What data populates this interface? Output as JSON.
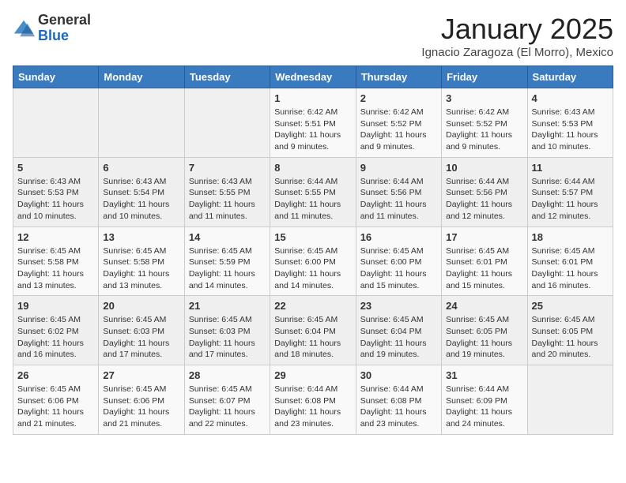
{
  "logo": {
    "general": "General",
    "blue": "Blue"
  },
  "header": {
    "title": "January 2025",
    "subtitle": "Ignacio Zaragoza (El Morro), Mexico"
  },
  "weekdays": [
    "Sunday",
    "Monday",
    "Tuesday",
    "Wednesday",
    "Thursday",
    "Friday",
    "Saturday"
  ],
  "weeks": [
    [
      {
        "day": "",
        "info": ""
      },
      {
        "day": "",
        "info": ""
      },
      {
        "day": "",
        "info": ""
      },
      {
        "day": "1",
        "info": "Sunrise: 6:42 AM\nSunset: 5:51 PM\nDaylight: 11 hours and 9 minutes."
      },
      {
        "day": "2",
        "info": "Sunrise: 6:42 AM\nSunset: 5:52 PM\nDaylight: 11 hours and 9 minutes."
      },
      {
        "day": "3",
        "info": "Sunrise: 6:42 AM\nSunset: 5:52 PM\nDaylight: 11 hours and 9 minutes."
      },
      {
        "day": "4",
        "info": "Sunrise: 6:43 AM\nSunset: 5:53 PM\nDaylight: 11 hours and 10 minutes."
      }
    ],
    [
      {
        "day": "5",
        "info": "Sunrise: 6:43 AM\nSunset: 5:53 PM\nDaylight: 11 hours and 10 minutes."
      },
      {
        "day": "6",
        "info": "Sunrise: 6:43 AM\nSunset: 5:54 PM\nDaylight: 11 hours and 10 minutes."
      },
      {
        "day": "7",
        "info": "Sunrise: 6:43 AM\nSunset: 5:55 PM\nDaylight: 11 hours and 11 minutes."
      },
      {
        "day": "8",
        "info": "Sunrise: 6:44 AM\nSunset: 5:55 PM\nDaylight: 11 hours and 11 minutes."
      },
      {
        "day": "9",
        "info": "Sunrise: 6:44 AM\nSunset: 5:56 PM\nDaylight: 11 hours and 11 minutes."
      },
      {
        "day": "10",
        "info": "Sunrise: 6:44 AM\nSunset: 5:56 PM\nDaylight: 11 hours and 12 minutes."
      },
      {
        "day": "11",
        "info": "Sunrise: 6:44 AM\nSunset: 5:57 PM\nDaylight: 11 hours and 12 minutes."
      }
    ],
    [
      {
        "day": "12",
        "info": "Sunrise: 6:45 AM\nSunset: 5:58 PM\nDaylight: 11 hours and 13 minutes."
      },
      {
        "day": "13",
        "info": "Sunrise: 6:45 AM\nSunset: 5:58 PM\nDaylight: 11 hours and 13 minutes."
      },
      {
        "day": "14",
        "info": "Sunrise: 6:45 AM\nSunset: 5:59 PM\nDaylight: 11 hours and 14 minutes."
      },
      {
        "day": "15",
        "info": "Sunrise: 6:45 AM\nSunset: 6:00 PM\nDaylight: 11 hours and 14 minutes."
      },
      {
        "day": "16",
        "info": "Sunrise: 6:45 AM\nSunset: 6:00 PM\nDaylight: 11 hours and 15 minutes."
      },
      {
        "day": "17",
        "info": "Sunrise: 6:45 AM\nSunset: 6:01 PM\nDaylight: 11 hours and 15 minutes."
      },
      {
        "day": "18",
        "info": "Sunrise: 6:45 AM\nSunset: 6:01 PM\nDaylight: 11 hours and 16 minutes."
      }
    ],
    [
      {
        "day": "19",
        "info": "Sunrise: 6:45 AM\nSunset: 6:02 PM\nDaylight: 11 hours and 16 minutes."
      },
      {
        "day": "20",
        "info": "Sunrise: 6:45 AM\nSunset: 6:03 PM\nDaylight: 11 hours and 17 minutes."
      },
      {
        "day": "21",
        "info": "Sunrise: 6:45 AM\nSunset: 6:03 PM\nDaylight: 11 hours and 17 minutes."
      },
      {
        "day": "22",
        "info": "Sunrise: 6:45 AM\nSunset: 6:04 PM\nDaylight: 11 hours and 18 minutes."
      },
      {
        "day": "23",
        "info": "Sunrise: 6:45 AM\nSunset: 6:04 PM\nDaylight: 11 hours and 19 minutes."
      },
      {
        "day": "24",
        "info": "Sunrise: 6:45 AM\nSunset: 6:05 PM\nDaylight: 11 hours and 19 minutes."
      },
      {
        "day": "25",
        "info": "Sunrise: 6:45 AM\nSunset: 6:05 PM\nDaylight: 11 hours and 20 minutes."
      }
    ],
    [
      {
        "day": "26",
        "info": "Sunrise: 6:45 AM\nSunset: 6:06 PM\nDaylight: 11 hours and 21 minutes."
      },
      {
        "day": "27",
        "info": "Sunrise: 6:45 AM\nSunset: 6:06 PM\nDaylight: 11 hours and 21 minutes."
      },
      {
        "day": "28",
        "info": "Sunrise: 6:45 AM\nSunset: 6:07 PM\nDaylight: 11 hours and 22 minutes."
      },
      {
        "day": "29",
        "info": "Sunrise: 6:44 AM\nSunset: 6:08 PM\nDaylight: 11 hours and 23 minutes."
      },
      {
        "day": "30",
        "info": "Sunrise: 6:44 AM\nSunset: 6:08 PM\nDaylight: 11 hours and 23 minutes."
      },
      {
        "day": "31",
        "info": "Sunrise: 6:44 AM\nSunset: 6:09 PM\nDaylight: 11 hours and 24 minutes."
      },
      {
        "day": "",
        "info": ""
      }
    ]
  ]
}
